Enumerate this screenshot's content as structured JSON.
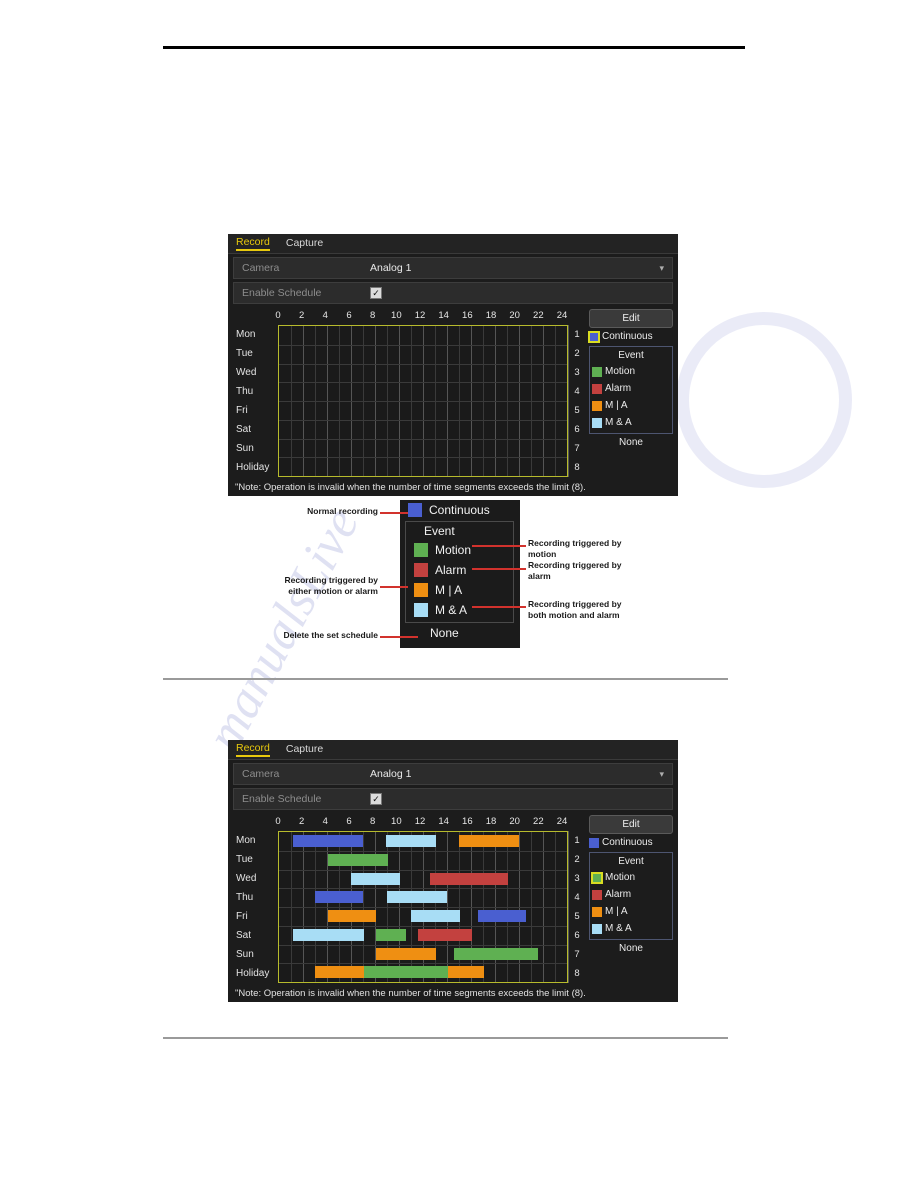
{
  "page": {
    "background": "#ffffff",
    "watermark_text": "manualsLive.com"
  },
  "panels": [
    {
      "id": "panel-empty",
      "tabs": [
        {
          "label": "Record",
          "active": true
        },
        {
          "label": "Capture",
          "active": false
        }
      ],
      "fields": [
        {
          "label": "Camera",
          "value": "Analog 1",
          "type": "select"
        },
        {
          "label": "Enable Schedule",
          "value": "",
          "type": "checkbox",
          "checked": true
        }
      ],
      "ruler_ticks": [
        "0",
        "2",
        "4",
        "6",
        "8",
        "10",
        "12",
        "14",
        "16",
        "18",
        "20",
        "22",
        "24"
      ],
      "days": [
        "Mon",
        "Tue",
        "Wed",
        "Thu",
        "Fri",
        "Sat",
        "Sun",
        "Holiday"
      ],
      "row_numbers": [
        "1",
        "2",
        "3",
        "4",
        "5",
        "6",
        "7",
        "8"
      ],
      "blocks": [],
      "edit_label": "Edit",
      "legend": {
        "continuous": {
          "label": "Continuous",
          "color": "#4a5fd0",
          "selected": true
        },
        "event_title": "Event",
        "items": [
          {
            "label": "Motion",
            "color": "#5fb052",
            "selected": false
          },
          {
            "label": "Alarm",
            "color": "#c3413f",
            "selected": false
          },
          {
            "label": "M | A",
            "color": "#ef8f12",
            "selected": false
          },
          {
            "label": "M & A",
            "color": "#a8ddf5",
            "selected": false
          }
        ],
        "none_label": "None"
      },
      "note": "\"Note: Operation is invalid when the number of time segments exceeds the limit (8)."
    },
    {
      "id": "panel-filled",
      "tabs": [
        {
          "label": "Record",
          "active": true
        },
        {
          "label": "Capture",
          "active": false
        }
      ],
      "fields": [
        {
          "label": "Camera",
          "value": "Analog 1",
          "type": "select"
        },
        {
          "label": "Enable Schedule",
          "value": "",
          "type": "checkbox",
          "checked": true
        }
      ],
      "ruler_ticks": [
        "0",
        "2",
        "4",
        "6",
        "8",
        "10",
        "12",
        "14",
        "16",
        "18",
        "20",
        "22",
        "24"
      ],
      "days": [
        "Mon",
        "Tue",
        "Wed",
        "Thu",
        "Fri",
        "Sat",
        "Sun",
        "Holiday"
      ],
      "row_numbers": [
        "1",
        "2",
        "3",
        "4",
        "5",
        "6",
        "7",
        "8"
      ],
      "blocks": [
        {
          "day": 0,
          "start": 1.2,
          "end": 7.0,
          "type": "Continuous",
          "color": "#4a5fd0"
        },
        {
          "day": 0,
          "start": 8.9,
          "end": 13.1,
          "type": "M & A",
          "color": "#a8ddf5"
        },
        {
          "day": 0,
          "start": 15.0,
          "end": 20.0,
          "type": "M | A",
          "color": "#ef8f12"
        },
        {
          "day": 1,
          "start": 4.1,
          "end": 9.1,
          "type": "Motion",
          "color": "#5fb052"
        },
        {
          "day": 2,
          "start": 6.0,
          "end": 10.1,
          "type": "M & A",
          "color": "#a8ddf5"
        },
        {
          "day": 2,
          "start": 12.6,
          "end": 19.1,
          "type": "Alarm",
          "color": "#c3413f"
        },
        {
          "day": 3,
          "start": 3.0,
          "end": 7.0,
          "type": "Continuous",
          "color": "#4a5fd0"
        },
        {
          "day": 3,
          "start": 9.0,
          "end": 14.0,
          "type": "M & A",
          "color": "#a8ddf5"
        },
        {
          "day": 4,
          "start": 4.1,
          "end": 8.1,
          "type": "M | A",
          "color": "#ef8f12"
        },
        {
          "day": 4,
          "start": 11.0,
          "end": 15.1,
          "type": "M & A",
          "color": "#a8ddf5"
        },
        {
          "day": 4,
          "start": 16.6,
          "end": 20.6,
          "type": "Continuous",
          "color": "#4a5fd0"
        },
        {
          "day": 5,
          "start": 1.2,
          "end": 7.1,
          "type": "M & A",
          "color": "#a8ddf5"
        },
        {
          "day": 5,
          "start": 8.1,
          "end": 10.6,
          "type": "Motion",
          "color": "#5fb052"
        },
        {
          "day": 5,
          "start": 11.6,
          "end": 16.1,
          "type": "Alarm",
          "color": "#c3413f"
        },
        {
          "day": 6,
          "start": 8.1,
          "end": 13.1,
          "type": "M | A",
          "color": "#ef8f12"
        },
        {
          "day": 6,
          "start": 14.6,
          "end": 21.6,
          "type": "Motion",
          "color": "#5fb052"
        },
        {
          "day": 7,
          "start": 3.0,
          "end": 7.1,
          "type": "M | A",
          "color": "#ef8f12"
        },
        {
          "day": 7,
          "start": 7.1,
          "end": 14.1,
          "type": "Motion",
          "color": "#5fb052"
        },
        {
          "day": 7,
          "start": 14.1,
          "end": 17.1,
          "type": "M | A",
          "color": "#ef8f12"
        }
      ],
      "edit_label": "Edit",
      "legend": {
        "continuous": {
          "label": "Continuous",
          "color": "#4a5fd0",
          "selected": false
        },
        "event_title": "Event",
        "items": [
          {
            "label": "Motion",
            "color": "#5fb052",
            "selected": true
          },
          {
            "label": "Alarm",
            "color": "#c3413f",
            "selected": false
          },
          {
            "label": "M | A",
            "color": "#ef8f12",
            "selected": false
          },
          {
            "label": "M & A",
            "color": "#a8ddf5",
            "selected": false
          }
        ],
        "none_label": "None"
      },
      "note": "\"Note: Operation is invalid when the number of time segments exceeds the limit (8)."
    }
  ],
  "diagram": {
    "legend_rows": [
      {
        "label": "Continuous",
        "color": "#4a5fd0"
      },
      {
        "label": "Motion",
        "color": "#5fb052"
      },
      {
        "label": "Alarm",
        "color": "#c3413f"
      },
      {
        "label": "M | A",
        "color": "#ef8f12"
      },
      {
        "label": "M & A",
        "color": "#a8ddf5"
      }
    ],
    "event_title": "Event",
    "none_label": "None",
    "annotations": {
      "normal_recording": "Normal recording",
      "motion_trigger": "Recording triggered by\nmotion",
      "alarm_trigger": "Recording triggered by\nalarm",
      "either_trigger": "Recording triggered by\neither motion or alarm",
      "both_trigger": "Recording triggered by\nboth motion and alarm",
      "delete_schedule": "Delete the set schedule"
    },
    "leader_color": "#d2322d"
  }
}
